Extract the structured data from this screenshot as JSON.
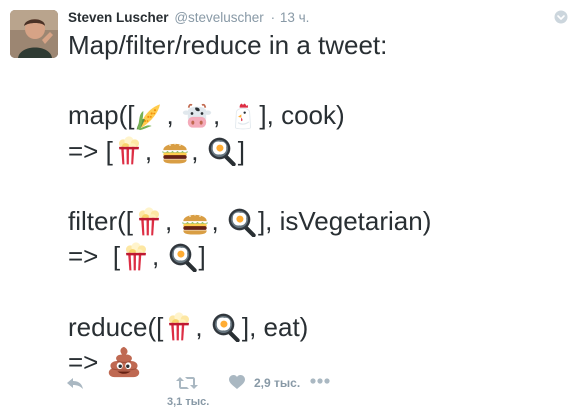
{
  "header": {
    "name": "Steven Luscher",
    "handle": "@steveluscher",
    "dot": "·",
    "time": "13 ч."
  },
  "tweet": {
    "line1": "Map/filter/reduce in a tweet:",
    "map_open": "map([",
    "comma": ",",
    "map_close": "], cook)",
    "arrow_bracket": "=> [",
    "close_bracket": "]",
    "filter_open": "filter([",
    "filter_close": "], isVegetarian)",
    "arrow_bracket_sp": "=>  [",
    "reduce_open": "reduce([",
    "reduce_close": "], eat)",
    "arrow": "=>"
  },
  "emoji": {
    "corn": "corn-emoji",
    "cow": "cow-emoji",
    "chicken": "chicken-emoji",
    "popcorn": "popcorn-emoji",
    "hamburger": "hamburger-emoji",
    "egg": "fried-egg-emoji",
    "poop": "pile-of-poo-emoji"
  },
  "actions": {
    "retweet_count": "3,1 тыс.",
    "like_count": "2,9 тыс."
  },
  "colors": {
    "name": "#292f33",
    "muted": "#8899a6",
    "action": "#aab8c2"
  }
}
